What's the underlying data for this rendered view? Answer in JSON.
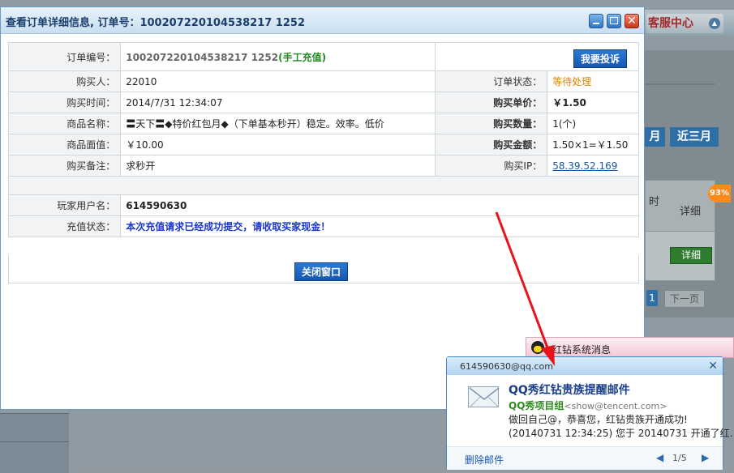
{
  "background": {
    "customer_service": "客服中心",
    "btn_month": "月",
    "btn_three_months": "近三月",
    "col_time": "时",
    "col_detail": "详细",
    "row_detail_btn": "详细",
    "page_current": "1",
    "page_next": "下一页",
    "progress_badge": "93%"
  },
  "dialog": {
    "title": "查看订单详细信息, 订单号：100207220104538217 1252",
    "complain_button": "我要投诉",
    "close_window_button": "关闭窗口",
    "rows": {
      "order_no_label": "订单编号：",
      "order_no_value": "100207220104538217 1252",
      "order_no_tag": "(手工充值)",
      "buyer_label": "购买人：",
      "buyer_value": "22010",
      "status_label": "订单状态：",
      "status_value": "等待处理",
      "time_label": "购买时间：",
      "time_value": "2014/7/31 12:34:07",
      "unit_price_label": "购买单价：",
      "unit_price_value": "￥1.50",
      "product_label": "商品名称：",
      "product_value": "〓天下〓◆特价红包月◆（下单基本秒开）稳定。效率。低价",
      "quantity_label": "购买数量：",
      "quantity_value": "1(个)",
      "face_value_label": "商品面值：",
      "face_value_value": "￥10.00",
      "amount_label": "购买金额：",
      "amount_value": "1.50×1=￥1.50",
      "note_label": "购买备注：",
      "note_value": "求秒开",
      "ip_label": "购买IP：",
      "ip_value": "58.39.52.169",
      "player_label": "玩家用户名：",
      "player_value": "614590630",
      "recharge_label": "充值状态：",
      "recharge_value": "本次充值请求已经成功提交，请收取买家现金！"
    }
  },
  "qq": {
    "tab_title": "红钻系统消息",
    "email": "614590630@qq.com",
    "subject": "QQ秀红钻贵族提醒邮件",
    "sender_name": "QQ秀项目组",
    "sender_addr": "<show@tencent.com>",
    "line1": "做回自己@，恭喜您，红钻贵族开通成功!",
    "line2": "(20140731 12:34:25) 您于 20140731 开通了红…",
    "delete": "删除邮件",
    "page": "1/5",
    "prev": "◀",
    "next": "▶"
  },
  "colors": {
    "accent": "#1458b0",
    "status_red": "#d30000",
    "status_orange": "#d98400",
    "arrow": "#e8141c"
  }
}
